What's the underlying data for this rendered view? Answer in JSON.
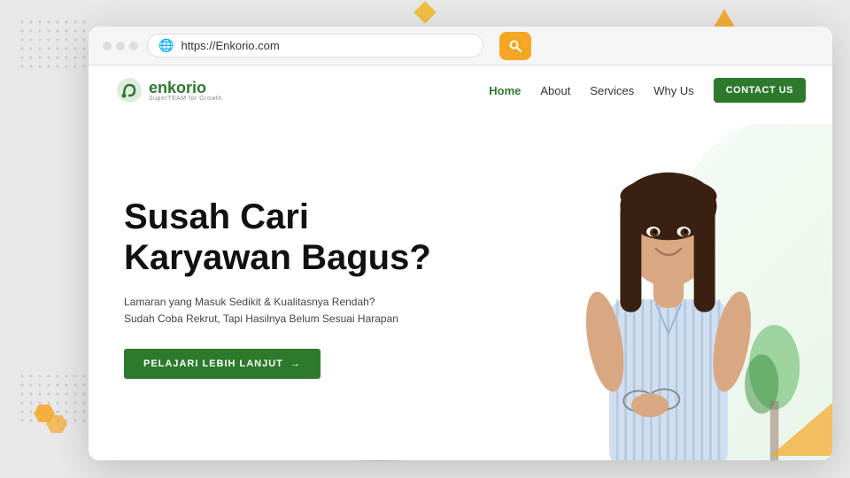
{
  "background": {
    "color": "#e8e8e8"
  },
  "browser": {
    "url": "https://Enkorio.com",
    "url_placeholder": "https://Enkorio.com"
  },
  "logo": {
    "name": "enkorio",
    "display": "enkorio",
    "tagline": "SuperTEAM for Growth"
  },
  "nav": {
    "links": [
      {
        "label": "Home",
        "active": true
      },
      {
        "label": "About",
        "active": false
      },
      {
        "label": "Services",
        "active": false
      },
      {
        "label": "Why Us",
        "active": false
      }
    ],
    "contact_label": "CONTACT US"
  },
  "hero": {
    "title_line1": "Susah Cari",
    "title_line2": "Karyawan Bagus?",
    "subtitle_line1": "Lamaran yang Masuk Sedikit & Kualitasnya Rendah?",
    "subtitle_line2": "Sudah Coba Rekrut, Tapi Hasilnya Belum Sesuai Harapan",
    "cta_label": "PELAJARI LEBIH LANJUT",
    "cta_arrow": "→"
  },
  "icons": {
    "globe": "🌐",
    "search": "🔍",
    "arrow_right": "→"
  }
}
